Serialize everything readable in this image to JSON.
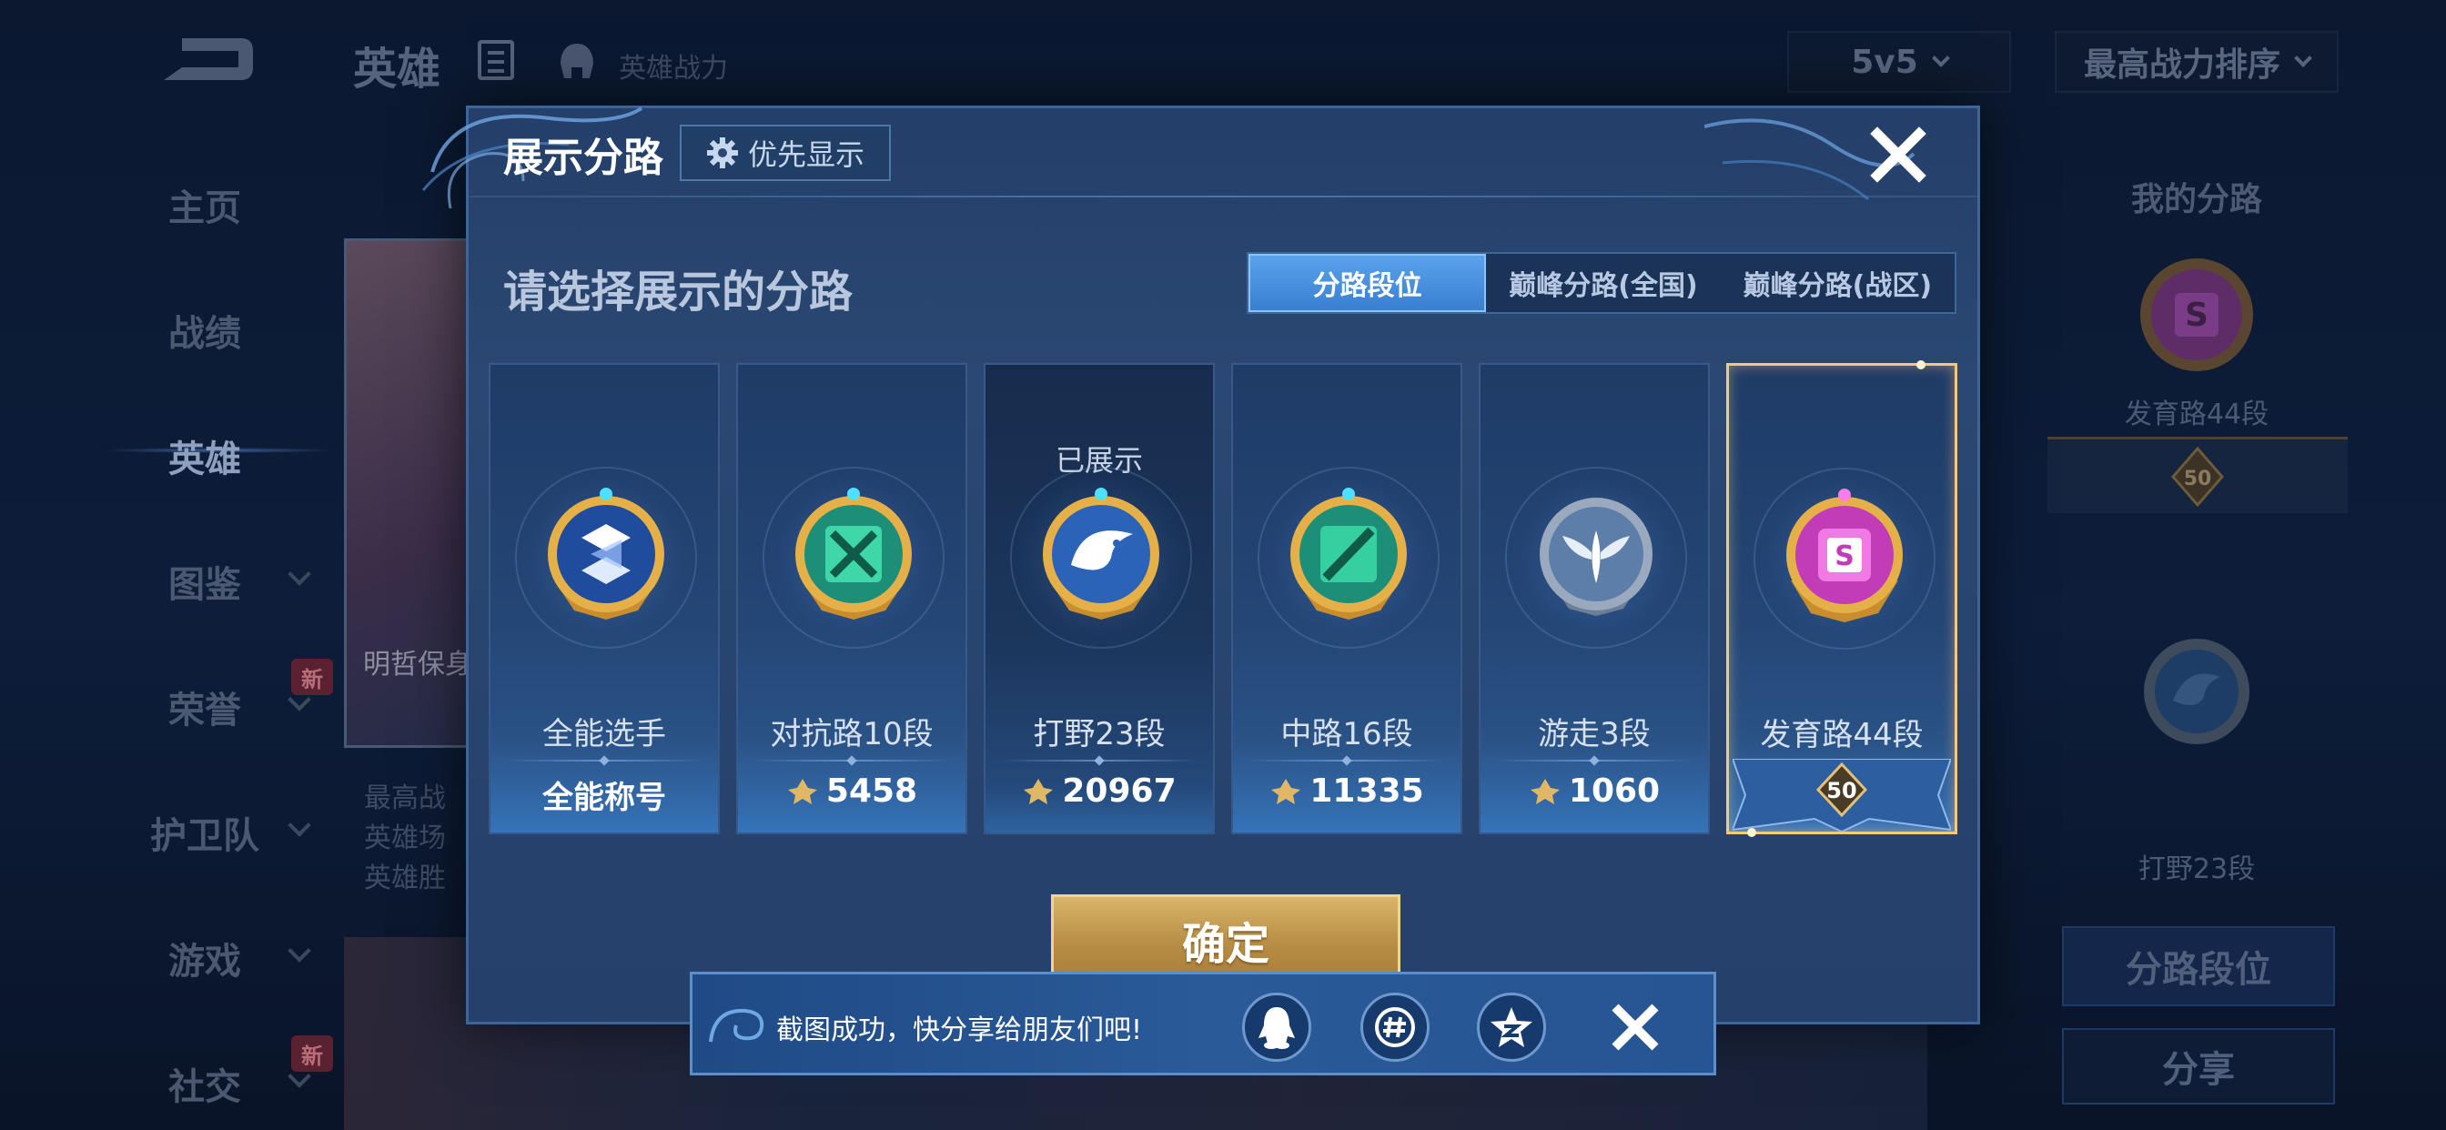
{
  "background": {
    "top_title": "英雄",
    "top_subtitle": "英雄战力",
    "mode_select": "5v5",
    "sort_select": "最高战力排序",
    "nav": [
      {
        "label": "主页",
        "active": false
      },
      {
        "label": "战绩",
        "active": false
      },
      {
        "label": "英雄",
        "active": true
      },
      {
        "label": "图鉴",
        "active": false
      },
      {
        "label": "荣誉",
        "active": false,
        "badge": "新"
      },
      {
        "label": "护卫队",
        "active": false
      },
      {
        "label": "游戏",
        "active": false
      },
      {
        "label": "社交",
        "active": false,
        "badge": "新"
      }
    ],
    "hero_card_name": "明哲保身",
    "hero_info_lines": [
      "最高战",
      "英雄场",
      "英雄胜"
    ],
    "right_panel": {
      "title": "我的分路",
      "lane1": "发育路44段",
      "lane1_level": "50",
      "lane2": "打野23段",
      "btn_lane": "分路段位",
      "btn_share": "分享"
    }
  },
  "modal": {
    "title": "展示分路",
    "priority_button": "优先显示",
    "subtitle": "请选择展示的分路",
    "tabs": [
      {
        "label": "分路段位",
        "active": true
      },
      {
        "label": "巅峰分路(全国)",
        "active": false
      },
      {
        "label": "巅峰分路(战区)",
        "active": false
      }
    ],
    "cards": [
      {
        "name": "全能选手",
        "value": "全能称号",
        "shown": "",
        "selected": false
      },
      {
        "name": "对抗路10段",
        "value": "5458",
        "shown": "",
        "selected": false
      },
      {
        "name": "打野23段",
        "value": "20967",
        "shown": "已展示",
        "selected": false
      },
      {
        "name": "中路16段",
        "value": "11335",
        "shown": "",
        "selected": false
      },
      {
        "name": "游走3段",
        "value": "1060",
        "shown": "",
        "selected": false
      },
      {
        "name": "发育路44段",
        "value": "50",
        "shown": "",
        "selected": true
      }
    ],
    "confirm_button": "确定"
  },
  "toast": {
    "message": "截图成功，快分享给朋友们吧!"
  },
  "colors": {
    "accent_blue": "#3a7fd0",
    "gold": "#d9b56a",
    "selected_border": "#f3c980",
    "jungle_medal": "#2a63b8",
    "top_medal": "#33c49a",
    "mid_medal": "#2fc49a",
    "adc_medal": "#e04fd0"
  }
}
